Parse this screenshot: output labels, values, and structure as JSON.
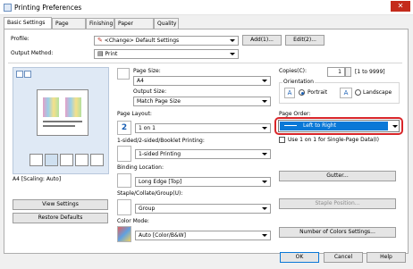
{
  "window": {
    "title": "Printing Preferences",
    "close": "✕"
  },
  "tabs": [
    "Basic Settings",
    "Page Setup",
    "Finishing",
    "Paper Source",
    "Quality"
  ],
  "profile": {
    "label": "Profile:",
    "value": "<Change> Default Settings",
    "add": "Add(1)...",
    "edit": "Edit(2)..."
  },
  "output_method": {
    "label": "Output Method:",
    "value": "Print"
  },
  "preview": {
    "caption": "A4 [Scaling: Auto]",
    "view_settings": "View Settings",
    "restore_defaults": "Restore Defaults"
  },
  "page_size": {
    "label": "Page Size:",
    "value": "A4"
  },
  "output_size": {
    "label": "Output Size:",
    "value": "Match Page Size"
  },
  "copies": {
    "label": "Copies(C):",
    "value": "1",
    "range": "[1 to 9999]"
  },
  "orientation": {
    "label": "Orientation",
    "portrait": "Portrait",
    "landscape": "Landscape",
    "selected": "Portrait"
  },
  "page_layout": {
    "label": "Page Layout:",
    "value": "1 on 1",
    "icon_text": "2"
  },
  "page_order": {
    "label": "Page Order:",
    "value": "Left to Right",
    "highlight_color": "#d9262a",
    "selected_color": "#0a78d7"
  },
  "use_1on1": {
    "label": "Use 1 on 1 for Single-Page Data(I)"
  },
  "duplex": {
    "label": "1-sided/2-sided/Booklet Printing:",
    "value": "1-sided Printing"
  },
  "binding": {
    "label": "Binding Location:",
    "value": "Long Edge [Top]",
    "gutter": "Gutter..."
  },
  "staple": {
    "label": "Staple/Collate/Group(U):",
    "value": "Group",
    "staple_position": "Staple Position..."
  },
  "color_mode": {
    "label": "Color Mode:",
    "value": "Auto [Color/B&W]",
    "num_colors": "Number of Colors Settings..."
  },
  "footer": {
    "ok": "OK",
    "cancel": "Cancel",
    "help": "Help"
  }
}
